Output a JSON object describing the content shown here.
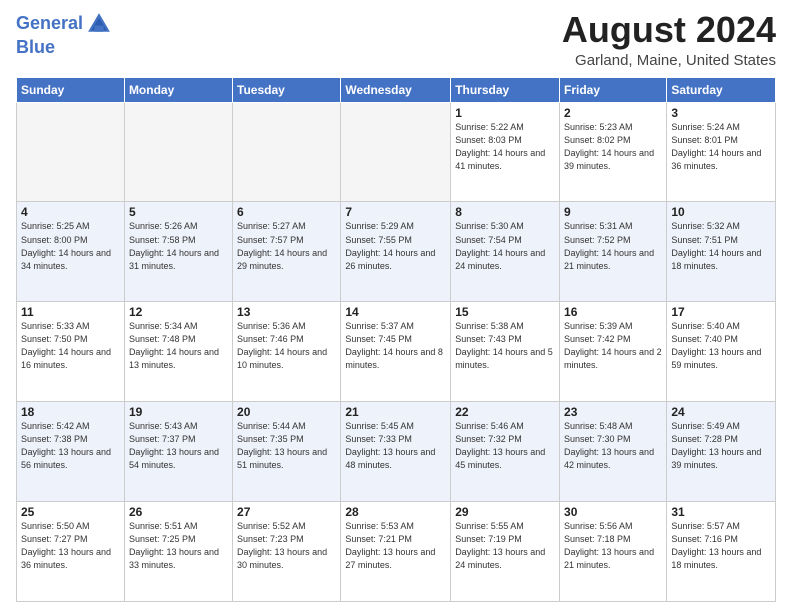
{
  "header": {
    "logo_line1": "General",
    "logo_line2": "Blue",
    "month": "August 2024",
    "location": "Garland, Maine, United States"
  },
  "weekdays": [
    "Sunday",
    "Monday",
    "Tuesday",
    "Wednesday",
    "Thursday",
    "Friday",
    "Saturday"
  ],
  "weeks": [
    [
      {
        "day": "",
        "empty": true
      },
      {
        "day": "",
        "empty": true
      },
      {
        "day": "",
        "empty": true
      },
      {
        "day": "",
        "empty": true
      },
      {
        "day": "1",
        "sunrise": "5:22 AM",
        "sunset": "8:03 PM",
        "daylight": "14 hours and 41 minutes."
      },
      {
        "day": "2",
        "sunrise": "5:23 AM",
        "sunset": "8:02 PM",
        "daylight": "14 hours and 39 minutes."
      },
      {
        "day": "3",
        "sunrise": "5:24 AM",
        "sunset": "8:01 PM",
        "daylight": "14 hours and 36 minutes."
      }
    ],
    [
      {
        "day": "4",
        "sunrise": "5:25 AM",
        "sunset": "8:00 PM",
        "daylight": "14 hours and 34 minutes."
      },
      {
        "day": "5",
        "sunrise": "5:26 AM",
        "sunset": "7:58 PM",
        "daylight": "14 hours and 31 minutes."
      },
      {
        "day": "6",
        "sunrise": "5:27 AM",
        "sunset": "7:57 PM",
        "daylight": "14 hours and 29 minutes."
      },
      {
        "day": "7",
        "sunrise": "5:29 AM",
        "sunset": "7:55 PM",
        "daylight": "14 hours and 26 minutes."
      },
      {
        "day": "8",
        "sunrise": "5:30 AM",
        "sunset": "7:54 PM",
        "daylight": "14 hours and 24 minutes."
      },
      {
        "day": "9",
        "sunrise": "5:31 AM",
        "sunset": "7:52 PM",
        "daylight": "14 hours and 21 minutes."
      },
      {
        "day": "10",
        "sunrise": "5:32 AM",
        "sunset": "7:51 PM",
        "daylight": "14 hours and 18 minutes."
      }
    ],
    [
      {
        "day": "11",
        "sunrise": "5:33 AM",
        "sunset": "7:50 PM",
        "daylight": "14 hours and 16 minutes."
      },
      {
        "day": "12",
        "sunrise": "5:34 AM",
        "sunset": "7:48 PM",
        "daylight": "14 hours and 13 minutes."
      },
      {
        "day": "13",
        "sunrise": "5:36 AM",
        "sunset": "7:46 PM",
        "daylight": "14 hours and 10 minutes."
      },
      {
        "day": "14",
        "sunrise": "5:37 AM",
        "sunset": "7:45 PM",
        "daylight": "14 hours and 8 minutes."
      },
      {
        "day": "15",
        "sunrise": "5:38 AM",
        "sunset": "7:43 PM",
        "daylight": "14 hours and 5 minutes."
      },
      {
        "day": "16",
        "sunrise": "5:39 AM",
        "sunset": "7:42 PM",
        "daylight": "14 hours and 2 minutes."
      },
      {
        "day": "17",
        "sunrise": "5:40 AM",
        "sunset": "7:40 PM",
        "daylight": "13 hours and 59 minutes."
      }
    ],
    [
      {
        "day": "18",
        "sunrise": "5:42 AM",
        "sunset": "7:38 PM",
        "daylight": "13 hours and 56 minutes."
      },
      {
        "day": "19",
        "sunrise": "5:43 AM",
        "sunset": "7:37 PM",
        "daylight": "13 hours and 54 minutes."
      },
      {
        "day": "20",
        "sunrise": "5:44 AM",
        "sunset": "7:35 PM",
        "daylight": "13 hours and 51 minutes."
      },
      {
        "day": "21",
        "sunrise": "5:45 AM",
        "sunset": "7:33 PM",
        "daylight": "13 hours and 48 minutes."
      },
      {
        "day": "22",
        "sunrise": "5:46 AM",
        "sunset": "7:32 PM",
        "daylight": "13 hours and 45 minutes."
      },
      {
        "day": "23",
        "sunrise": "5:48 AM",
        "sunset": "7:30 PM",
        "daylight": "13 hours and 42 minutes."
      },
      {
        "day": "24",
        "sunrise": "5:49 AM",
        "sunset": "7:28 PM",
        "daylight": "13 hours and 39 minutes."
      }
    ],
    [
      {
        "day": "25",
        "sunrise": "5:50 AM",
        "sunset": "7:27 PM",
        "daylight": "13 hours and 36 minutes."
      },
      {
        "day": "26",
        "sunrise": "5:51 AM",
        "sunset": "7:25 PM",
        "daylight": "13 hours and 33 minutes."
      },
      {
        "day": "27",
        "sunrise": "5:52 AM",
        "sunset": "7:23 PM",
        "daylight": "13 hours and 30 minutes."
      },
      {
        "day": "28",
        "sunrise": "5:53 AM",
        "sunset": "7:21 PM",
        "daylight": "13 hours and 27 minutes."
      },
      {
        "day": "29",
        "sunrise": "5:55 AM",
        "sunset": "7:19 PM",
        "daylight": "13 hours and 24 minutes."
      },
      {
        "day": "30",
        "sunrise": "5:56 AM",
        "sunset": "7:18 PM",
        "daylight": "13 hours and 21 minutes."
      },
      {
        "day": "31",
        "sunrise": "5:57 AM",
        "sunset": "7:16 PM",
        "daylight": "13 hours and 18 minutes."
      }
    ]
  ]
}
